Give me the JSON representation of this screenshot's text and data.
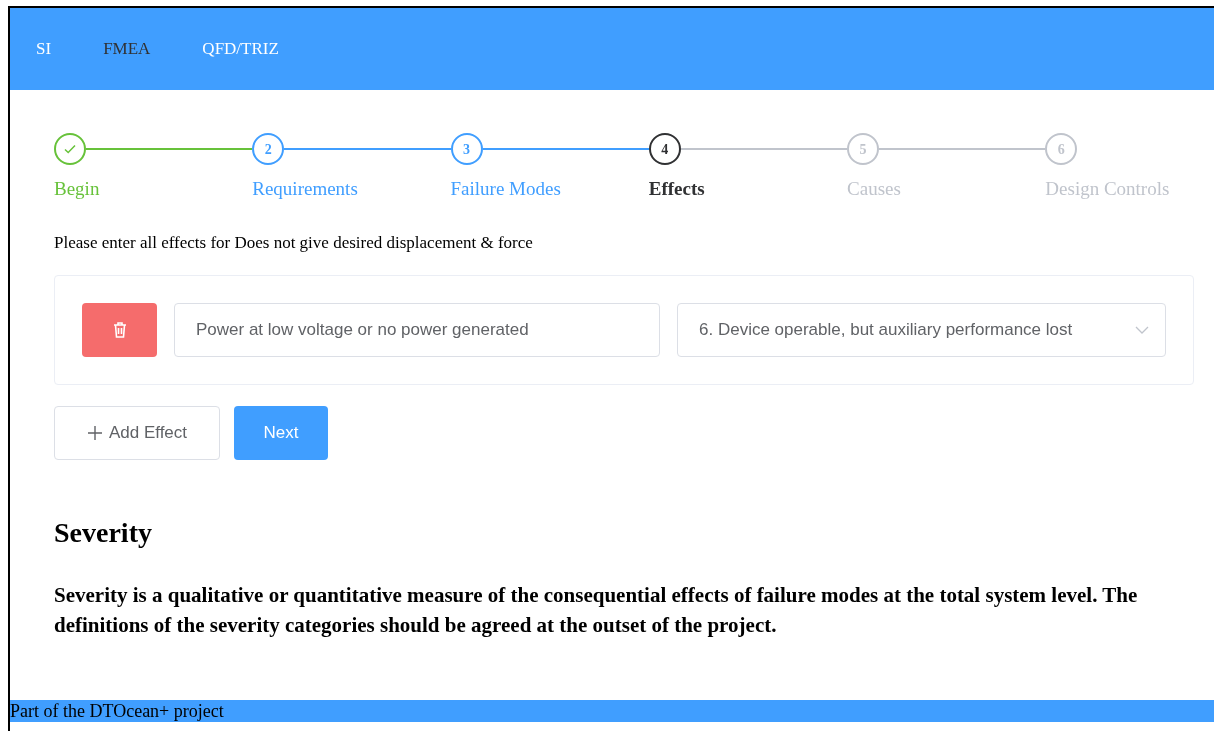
{
  "nav": [
    {
      "label": "SI",
      "selected": false
    },
    {
      "label": "FMEA",
      "selected": true
    },
    {
      "label": "QFD/TRIZ",
      "selected": false
    }
  ],
  "steps": [
    {
      "label": "Begin",
      "kind": "done"
    },
    {
      "number": "2",
      "label": "Requirements",
      "kind": "visited"
    },
    {
      "number": "3",
      "label": "Failure Modes",
      "kind": "visited"
    },
    {
      "number": "4",
      "label": "Effects",
      "kind": "current"
    },
    {
      "number": "5",
      "label": "Causes",
      "kind": "waiting"
    },
    {
      "number": "6",
      "label": "Design Controls",
      "kind": "waiting"
    }
  ],
  "prompt": "Please enter all effects for Does not give desired displacement & force",
  "effects": [
    {
      "description": "Power at low voltage or no power generated",
      "severity": "6. Device operable, but auxiliary performance lost"
    }
  ],
  "buttons": {
    "add": "Add Effect",
    "next": "Next"
  },
  "section": {
    "title": "Severity",
    "text": "Severity is a qualitative or quantitative measure of the consequential effects of failure modes at the total system level. The definitions of the severity categories should be agreed at the outset of the project."
  },
  "footer": "Part of the DTOcean+ project"
}
